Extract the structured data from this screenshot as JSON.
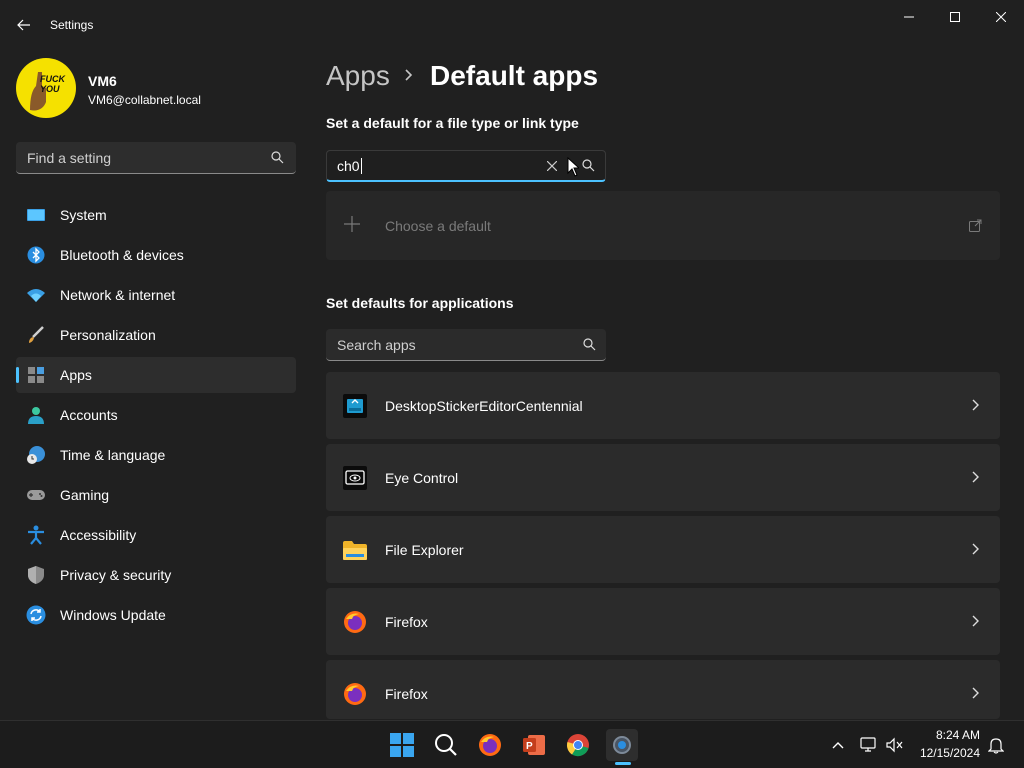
{
  "window": {
    "title": "Settings"
  },
  "profile": {
    "name": "VM6",
    "email": "VM6@collabnet.local",
    "avatar_text": "FUCK YOU"
  },
  "nav_search": {
    "placeholder": "Find a setting"
  },
  "sidebar": {
    "items": [
      {
        "label": "System",
        "icon": "system-icon"
      },
      {
        "label": "Bluetooth & devices",
        "icon": "bluetooth-icon"
      },
      {
        "label": "Network & internet",
        "icon": "wifi-icon"
      },
      {
        "label": "Personalization",
        "icon": "brush-icon"
      },
      {
        "label": "Apps",
        "icon": "apps-icon",
        "active": true
      },
      {
        "label": "Accounts",
        "icon": "person-icon"
      },
      {
        "label": "Time & language",
        "icon": "clock-globe-icon"
      },
      {
        "label": "Gaming",
        "icon": "gamepad-icon"
      },
      {
        "label": "Accessibility",
        "icon": "accessibility-icon"
      },
      {
        "label": "Privacy & security",
        "icon": "shield-icon"
      },
      {
        "label": "Windows Update",
        "icon": "update-icon"
      }
    ]
  },
  "breadcrumb": {
    "parent": "Apps",
    "current": "Default apps"
  },
  "filetype_section": {
    "title": "Set a default for a file type or link type",
    "search_value": "ch0",
    "choose_label": "Choose a default"
  },
  "apps_section": {
    "title": "Set defaults for applications",
    "search_placeholder": "Search apps",
    "apps": [
      {
        "name": "DesktopStickerEditorCentennial",
        "icon": "sticker-editor-icon"
      },
      {
        "name": "Eye Control",
        "icon": "eye-control-icon"
      },
      {
        "name": "File Explorer",
        "icon": "folder-icon"
      },
      {
        "name": "Firefox",
        "icon": "firefox-icon"
      },
      {
        "name": "Firefox",
        "icon": "firefox-icon"
      }
    ]
  },
  "taskbar": {
    "time": "8:24 AM",
    "date": "12/15/2024"
  },
  "colors": {
    "accent": "#4cc2ff",
    "background": "#202020",
    "card": "#2b2b2b"
  }
}
